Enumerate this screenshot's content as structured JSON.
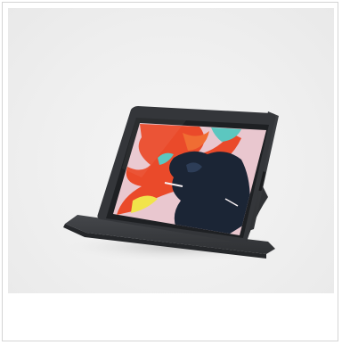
{
  "image": {
    "subject": "tablet-kiosk-stand",
    "colors": {
      "background": "#efefef",
      "stand": "#3b3d41",
      "stand_shadow": "#2b2d30",
      "bezel": "#1f2124",
      "screen_pink": "#e9c7cf",
      "screen_orange": "#ea4a2a",
      "screen_teal": "#5cc7c0",
      "screen_navy": "#1b2535",
      "screen_yellow": "#f1e44a"
    }
  }
}
